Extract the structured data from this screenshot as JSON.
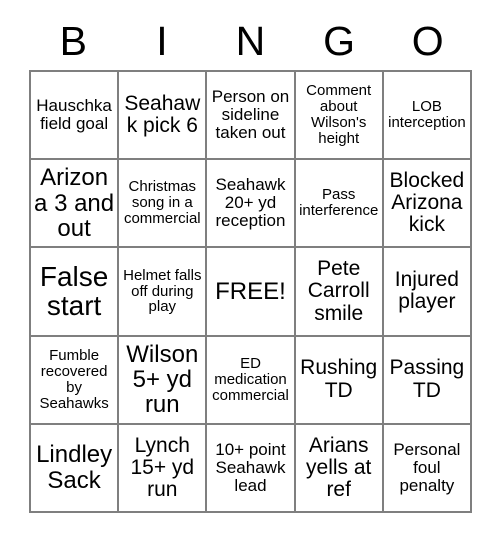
{
  "card": {
    "header_letters": [
      "B",
      "I",
      "N",
      "G",
      "O"
    ],
    "grid_columns": 5,
    "grid_rows": 5,
    "colors": {
      "background": "#ffffff",
      "text": "#000000",
      "border": "#7f7f7f"
    },
    "rows": [
      [
        {
          "text": "Hauschka field goal",
          "size": "sm"
        },
        {
          "text": "Seahawk pick 6",
          "size": "md"
        },
        {
          "text": "Person on sideline taken out",
          "size": "sm"
        },
        {
          "text": "Comment about Wilson's height",
          "size": "xs"
        },
        {
          "text": "LOB interception",
          "size": "xs"
        }
      ],
      [
        {
          "text": "Arizona 3 and out",
          "size": "lg"
        },
        {
          "text": "Christmas song in a commercial",
          "size": "xs"
        },
        {
          "text": "Seahawk 20+ yd reception",
          "size": "sm"
        },
        {
          "text": "Pass interference",
          "size": "xs"
        },
        {
          "text": "Blocked Arizona kick",
          "size": "md"
        }
      ],
      [
        {
          "text": "False start",
          "size": "xl"
        },
        {
          "text": "Helmet falls off during play",
          "size": "xs"
        },
        {
          "text": "FREE!",
          "size": "lg"
        },
        {
          "text": "Pete Carroll smile",
          "size": "md"
        },
        {
          "text": "Injured player",
          "size": "md"
        }
      ],
      [
        {
          "text": "Fumble recovered by Seahawks",
          "size": "xs"
        },
        {
          "text": "Wilson 5+ yd run",
          "size": "lg"
        },
        {
          "text": "ED medication commercial",
          "size": "xs"
        },
        {
          "text": "Rushing TD",
          "size": "md"
        },
        {
          "text": "Passing TD",
          "size": "md"
        }
      ],
      [
        {
          "text": "Lindley Sack",
          "size": "lg"
        },
        {
          "text": "Lynch 15+ yd run",
          "size": "md"
        },
        {
          "text": "10+ point Seahawk lead",
          "size": "sm"
        },
        {
          "text": "Arians yells at ref",
          "size": "md"
        },
        {
          "text": "Personal foul penalty",
          "size": "sm"
        }
      ]
    ]
  }
}
